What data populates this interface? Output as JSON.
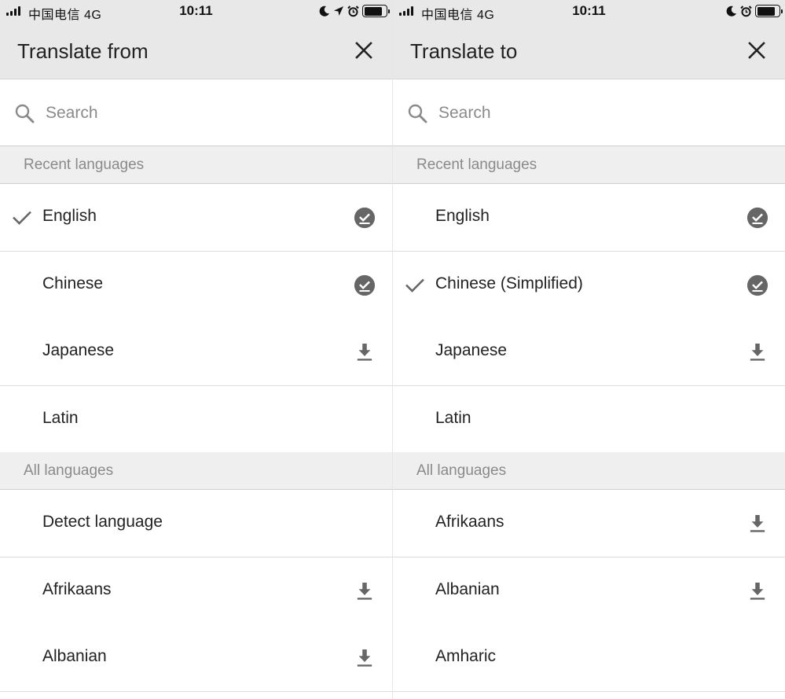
{
  "status_bar": {
    "left": {
      "carrier": "中国电信  4G",
      "time": "10:11"
    },
    "right": {
      "carrier": "中国电信  4G",
      "time": "10:11"
    }
  },
  "left_screen": {
    "title": "Translate from",
    "search": {
      "placeholder": "Search",
      "value": ""
    },
    "recent_header": "Recent languages",
    "recent": [
      {
        "label": "English",
        "selected": true,
        "status_icon": "downloaded-icon"
      },
      {
        "label": "Chinese",
        "selected": false,
        "status_icon": "downloaded-icon"
      },
      {
        "label": "Japanese",
        "selected": false,
        "status_icon": "download-icon"
      },
      {
        "label": "Latin",
        "selected": false,
        "status_icon": ""
      }
    ],
    "all_header": "All languages",
    "all": [
      {
        "label": "Detect language",
        "selected": false,
        "status_icon": ""
      },
      {
        "label": "Afrikaans",
        "selected": false,
        "status_icon": "download-icon"
      },
      {
        "label": "Albanian",
        "selected": false,
        "status_icon": "download-icon"
      }
    ]
  },
  "right_screen": {
    "title": "Translate to",
    "search": {
      "placeholder": "Search",
      "value": ""
    },
    "recent_header": "Recent languages",
    "recent": [
      {
        "label": "English",
        "selected": false,
        "status_icon": "downloaded-icon"
      },
      {
        "label": "Chinese (Simplified)",
        "selected": true,
        "status_icon": "downloaded-icon"
      },
      {
        "label": "Japanese",
        "selected": false,
        "status_icon": "download-icon"
      },
      {
        "label": "Latin",
        "selected": false,
        "status_icon": ""
      }
    ],
    "all_header": "All languages",
    "all": [
      {
        "label": "Afrikaans",
        "selected": false,
        "status_icon": "download-icon"
      },
      {
        "label": "Albanian",
        "selected": false,
        "status_icon": "download-icon"
      },
      {
        "label": "Amharic",
        "selected": false,
        "status_icon": ""
      }
    ]
  },
  "colors": {
    "header_bg": "#e8e8e8",
    "section_bg": "#efefef",
    "icon_gray": "#666666",
    "text_primary": "#222222",
    "text_secondary": "#8a8a8a"
  }
}
